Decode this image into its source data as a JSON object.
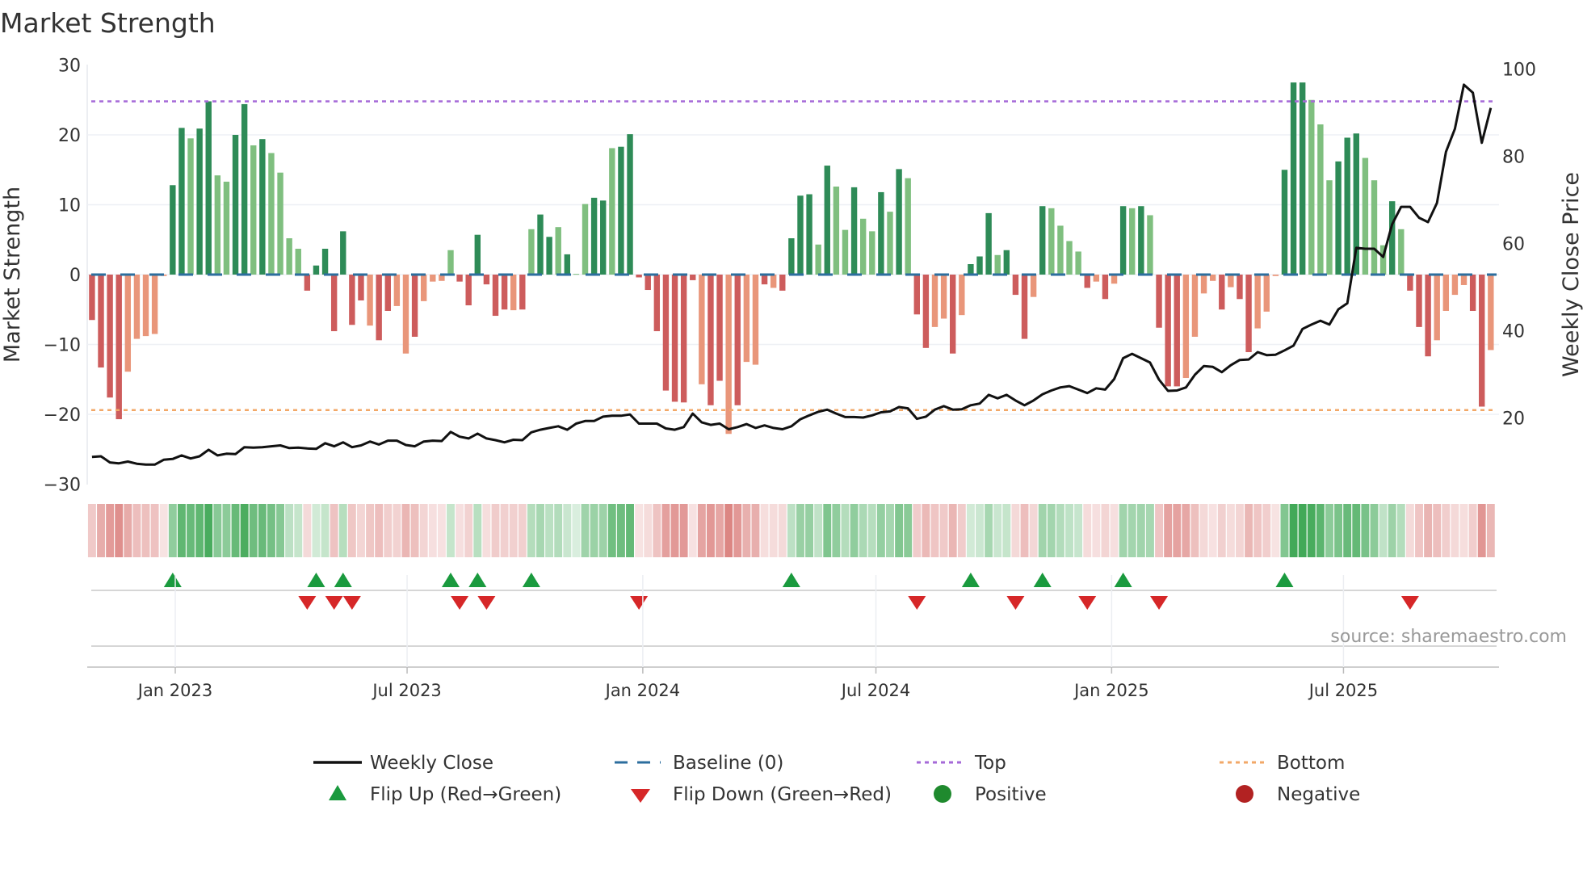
{
  "chart_data": {
    "type": "bar",
    "title": "Market Strength",
    "ylabel": "Market Strength",
    "y2label": "Weekly Close Price",
    "ylim": [
      -30,
      30
    ],
    "y2lim": [
      3,
      103
    ],
    "yticks": [
      30,
      20,
      10,
      0,
      -10,
      -20,
      -30
    ],
    "yticklabels": [
      "30",
      "20",
      "10",
      "0",
      "−10",
      "−20",
      "−30"
    ],
    "y2ticks": [
      100,
      80,
      60,
      40,
      20
    ],
    "y2ticklabels": [
      "100",
      "80",
      "60",
      "40",
      "20"
    ],
    "xticks": [
      "2023-01-01",
      "2023-07-01",
      "2024-01-01",
      "2024-07-01",
      "2025-01-01",
      "2025-07-01"
    ],
    "xticklabels": [
      "Jan 2023",
      "Jul 2023",
      "Jan 2024",
      "Jul 2024",
      "Jan 2025",
      "Jul 2025"
    ],
    "start_date": "2022-10-28",
    "interval_days": 7,
    "top_level": 24.8,
    "bottom_level": -19.4,
    "baseline": 0,
    "strength": [
      -6.5,
      -13.3,
      -17.6,
      -20.7,
      -13.9,
      -9.2,
      -8.8,
      -8.5,
      -0.2,
      12.8,
      21.0,
      19.5,
      20.9,
      24.8,
      14.2,
      13.3,
      20.0,
      24.4,
      18.5,
      19.4,
      17.4,
      14.6,
      5.2,
      3.7,
      -2.3,
      1.3,
      3.7,
      -8.1,
      6.2,
      -7.2,
      -3.7,
      -7.3,
      -9.4,
      -5.2,
      -4.5,
      -11.3,
      -8.9,
      -3.8,
      -1.0,
      -0.9,
      3.5,
      -1.0,
      -4.4,
      5.7,
      -1.4,
      -5.9,
      -5.0,
      -5.1,
      -5.0,
      6.5,
      8.6,
      5.4,
      6.8,
      2.9,
      0.1,
      10.1,
      11.0,
      10.6,
      18.1,
      18.3,
      20.1,
      -0.4,
      -2.2,
      -8.1,
      -16.6,
      -18.2,
      -18.3,
      -0.8,
      -15.7,
      -18.7,
      -15.2,
      -22.8,
      -18.7,
      -12.5,
      -12.9,
      -1.4,
      -1.9,
      -2.3,
      5.2,
      11.3,
      11.5,
      4.3,
      15.6,
      12.6,
      6.4,
      12.5,
      8.0,
      6.2,
      11.8,
      9.0,
      15.1,
      13.8,
      -5.7,
      -10.5,
      -7.5,
      -6.3,
      -11.3,
      -5.8,
      1.5,
      2.6,
      8.8,
      2.8,
      3.5,
      -2.9,
      -9.2,
      -3.2,
      9.8,
      9.5,
      7.0,
      4.8,
      3.3,
      -1.9,
      -1.0,
      -3.5,
      -1.3,
      9.8,
      9.5,
      9.8,
      8.5,
      -7.6,
      -16.0,
      -16.0,
      -14.8,
      -8.9,
      -2.7,
      -0.9,
      -5.0,
      -1.8,
      -3.5,
      -11.1,
      -7.7,
      -5.3,
      -0.2,
      15.0,
      27.5,
      27.5,
      25.0,
      21.5,
      13.5,
      16.2,
      19.6,
      20.2,
      16.7,
      13.5,
      4.2,
      10.5,
      6.5,
      -2.3,
      -7.5,
      -11.7,
      -9.4,
      -5.2,
      -2.9,
      -1.5,
      -5.2,
      -18.9,
      -10.8
    ],
    "shade": "ddddlllllddlddllddldlllldddddddlddlldllllddddddldlddldllddldddddddddlddldlldlddddldlldlldldlddlldlddd ldddldlllldldldldldddlllldldd llldddllldddllldlddd llllddl",
    "close": [
      11.05,
      11.2,
      9.8,
      9.6,
      10.0,
      9.5,
      9.3,
      9.3,
      10.4,
      10.6,
      11.4,
      10.7,
      11.2,
      12.7,
      11.4,
      11.8,
      11.7,
      13.3,
      13.2,
      13.3,
      13.5,
      13.7,
      13.1,
      13.2,
      13.0,
      12.9,
      14.2,
      13.5,
      14.4,
      13.3,
      13.7,
      14.6,
      13.9,
      14.8,
      14.8,
      13.8,
      13.5,
      14.6,
      14.8,
      14.7,
      16.8,
      15.7,
      15.3,
      16.4,
      15.3,
      14.9,
      14.4,
      15.0,
      14.9,
      16.7,
      17.3,
      17.7,
      18.1,
      17.3,
      18.7,
      19.3,
      19.3,
      20.3,
      20.5,
      20.5,
      20.8,
      18.7,
      18.7,
      18.7,
      17.6,
      17.3,
      17.9,
      21.0,
      19.0,
      18.4,
      18.7,
      17.4,
      17.9,
      18.6,
      17.7,
      18.3,
      17.7,
      17.4,
      18.1,
      19.7,
      20.6,
      21.4,
      21.9,
      21.0,
      20.2,
      20.2,
      20.1,
      20.6,
      21.3,
      21.5,
      22.5,
      22.2,
      19.8,
      20.3,
      21.9,
      22.7,
      21.9,
      22.0,
      22.9,
      23.3,
      25.3,
      24.5,
      25.3,
      24.0,
      22.9,
      24.0,
      25.4,
      26.3,
      27.0,
      27.3,
      26.5,
      25.7,
      26.8,
      26.5,
      28.9,
      33.7,
      34.7,
      33.7,
      32.7,
      28.8,
      26.2,
      26.3,
      27.0,
      29.9,
      31.9,
      31.7,
      30.5,
      32.1,
      33.3,
      33.4,
      35.1,
      34.4,
      34.5,
      35.5,
      36.6,
      40.4,
      41.4,
      42.3,
      41.4,
      44.9,
      46.3,
      59.0,
      58.8,
      58.8,
      56.9,
      64.4,
      68.4,
      68.4,
      65.9,
      64.9,
      69.3,
      81.0,
      86.3,
      96.4,
      94.6,
      83.1,
      91.1
    ],
    "flip_up": [
      9,
      25,
      28,
      40,
      43,
      49,
      78,
      98,
      106,
      115,
      133
    ],
    "flip_down": [
      24,
      27,
      29,
      41,
      44,
      61,
      92,
      103,
      111,
      119,
      147
    ],
    "colors": {
      "pos_dark": "#2e8b57",
      "pos_light": "#7fbf7f",
      "neg_dark": "#cd5c5c",
      "neg_light": "#e9967a",
      "line": "#111111",
      "baseline": "#2c6e9e",
      "top": "#a66ad8",
      "bottom": "#f2a868",
      "flip_up": "#1a9a3e",
      "flip_down": "#d62728",
      "positive": "#1f8a2e",
      "negative": "#b22222"
    },
    "legend": {
      "position": "bottom",
      "items": [
        "Weekly Close",
        "Baseline (0)",
        "Top",
        "Bottom",
        "Flip Up (Red→Green)",
        "Flip Down (Green→Red)",
        "Positive",
        "Negative"
      ]
    }
  },
  "source": "source: sharemaestro.com"
}
